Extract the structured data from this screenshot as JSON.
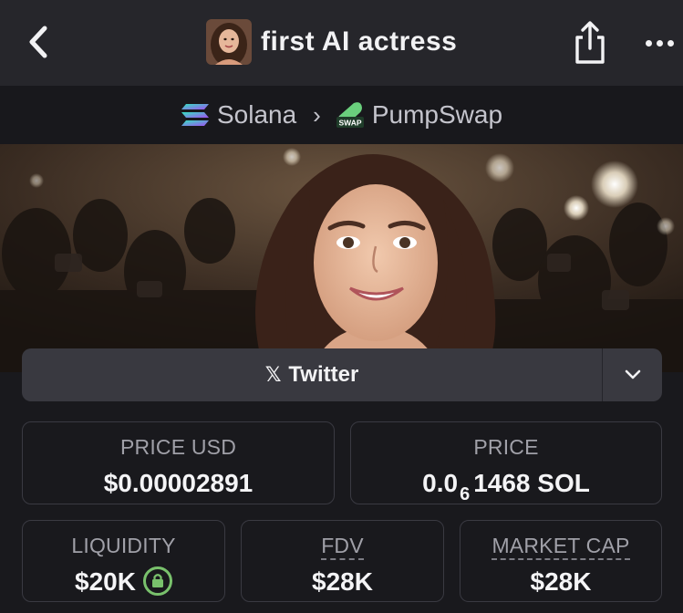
{
  "header": {
    "title": "first AI actress",
    "back_icon": "chevron-left-icon",
    "share_icon": "share-icon",
    "more_icon": "more-horizontal-icon"
  },
  "chain": {
    "network": "Solana",
    "dex": "PumpSwap",
    "dex_badge": "SWAP"
  },
  "social": {
    "twitter_label": "Twitter",
    "twitter_icon": "x-logo-icon",
    "dropdown_icon": "chevron-down-icon"
  },
  "stats": {
    "price_usd_label": "PRICE USD",
    "price_usd_value": "$0.00002891",
    "price_label": "PRICE",
    "price_prefix": "0.0",
    "price_zero_count": "6",
    "price_suffix": "1468 SOL",
    "liquidity_label": "LIQUIDITY",
    "liquidity_value": "$20K",
    "fdv_label": "FDV",
    "fdv_value": "$28K",
    "mcap_label": "MARKET CAP",
    "mcap_value": "$28K"
  },
  "colors": {
    "background": "#19191d",
    "header": "#26262b",
    "accent_green": "#79c16c"
  }
}
